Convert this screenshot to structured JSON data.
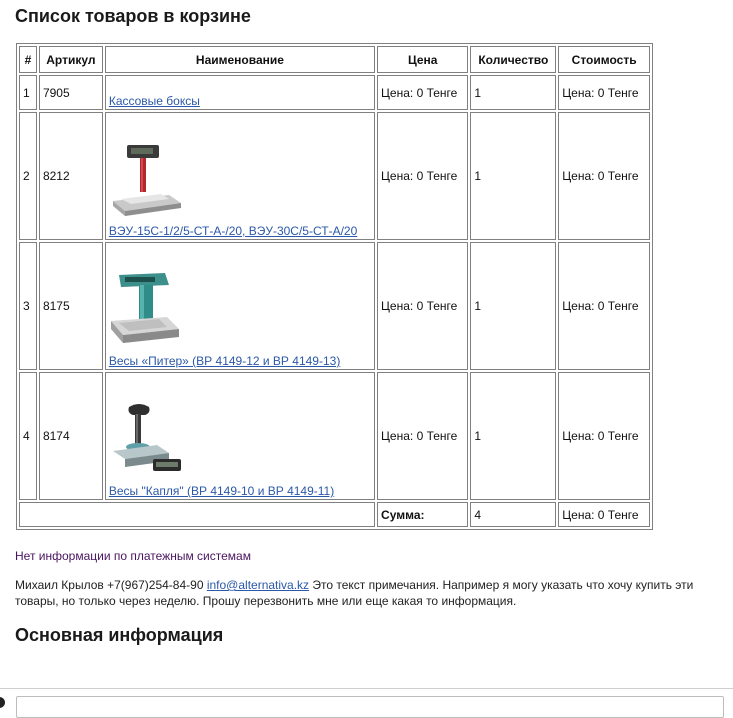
{
  "cart": {
    "title": "Список товаров в корзине",
    "columns": [
      "#",
      "Артикул",
      "Наименование",
      "Цена",
      "Количество",
      "Стоимость"
    ],
    "rows": [
      {
        "num": "1",
        "sku": "7905",
        "name": "Кассовые боксы",
        "price": "Цена: 0 Тенге",
        "qty": "1",
        "cost": "Цена: 0 Тенге",
        "image": ""
      },
      {
        "num": "2",
        "sku": "8212",
        "name": "ВЭУ-15С-1/2/5-СТ-А-/20, ВЭУ-30С/5-СТ-А/20",
        "price": "Цена: 0 Тенге",
        "qty": "1",
        "cost": "Цена: 0 Тенге",
        "image": "scale-red-pole-icon"
      },
      {
        "num": "3",
        "sku": "8175",
        "name": "Весы «Питер» (ВР 4149-12 и ВР 4149-13)",
        "price": "Цена: 0 Тенге",
        "qty": "1",
        "cost": "Цена: 0 Тенге",
        "image": "scale-teal-icon"
      },
      {
        "num": "4",
        "sku": "8174",
        "name": "Весы \"Капля\" (ВР 4149-10 и ВР 4149-11)",
        "price": "Цена: 0 Тенге",
        "qty": "1",
        "cost": "Цена: 0 Тенге",
        "image": "scale-drop-icon"
      }
    ],
    "summary": {
      "label": "Сумма:",
      "qty": "4",
      "cost": "Цена: 0 Тенге"
    }
  },
  "payment_note": "Нет информации по платежным системам",
  "comment": {
    "contact": "Михаил Крылов +7(967)254-84-90 ",
    "email": "info@alternativa.kz",
    "text": " Это текст примечания. Например я могу указать что хочу купить эти товары, но только через неделю. Прошу перезвонить мне или еще какая то информация."
  },
  "main_info_title": "Основная информация",
  "colors": {
    "link": "#2b58a8",
    "note": "#4a1560",
    "border": "#808080"
  }
}
